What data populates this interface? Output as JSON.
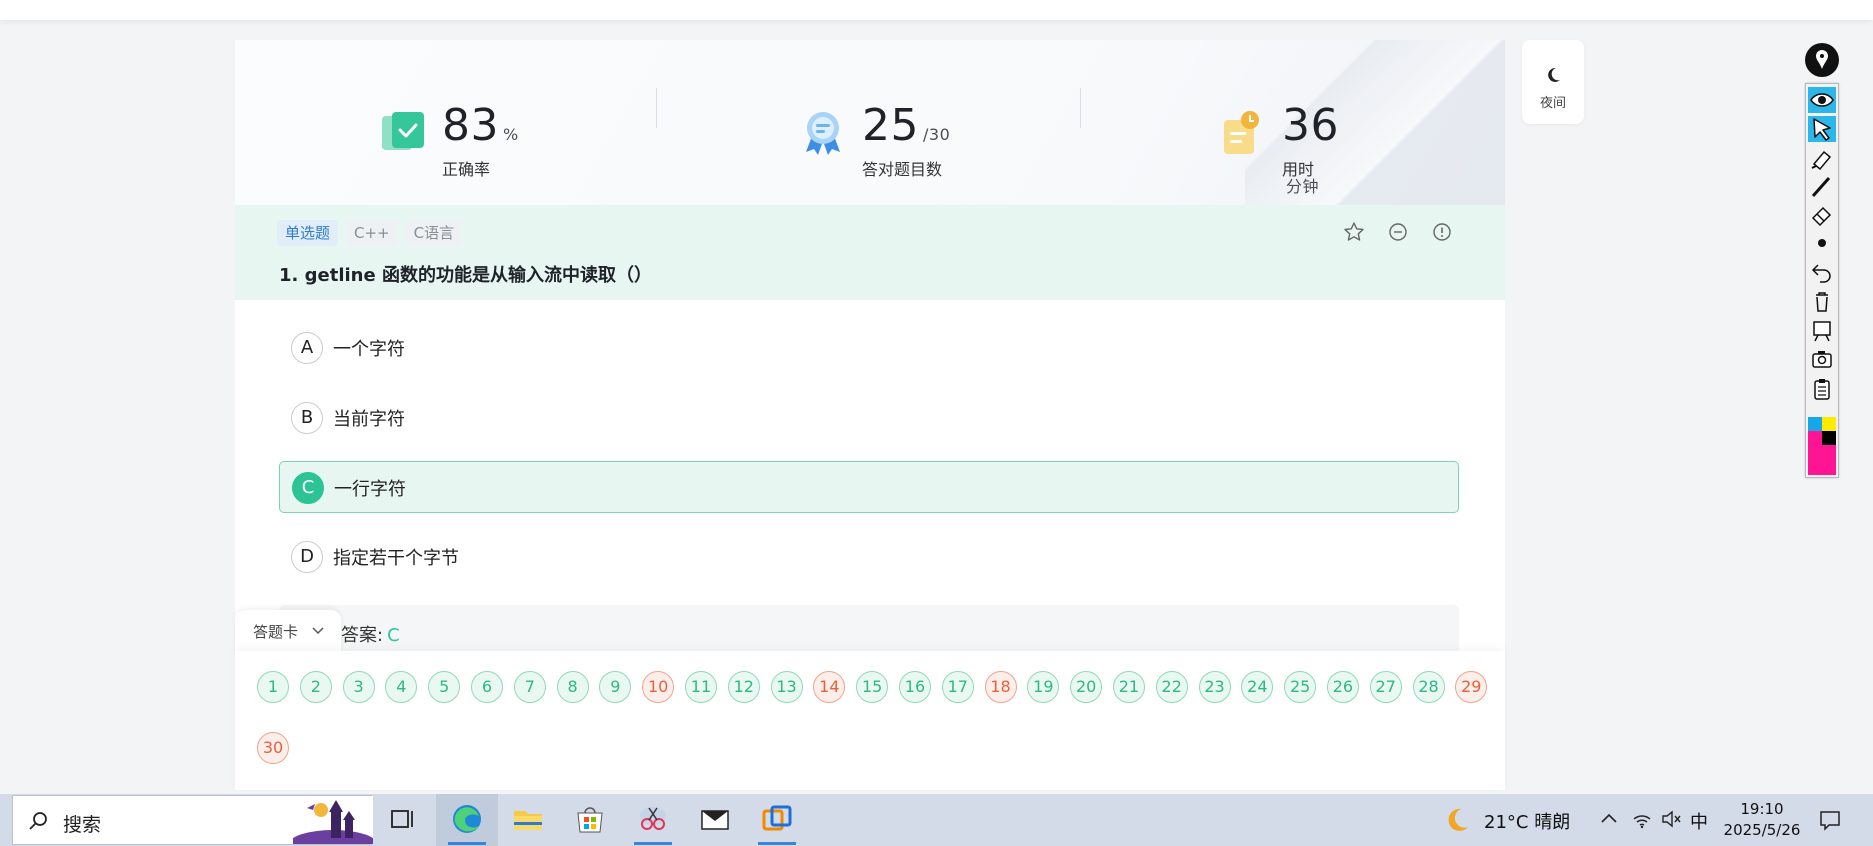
{
  "stats": [
    {
      "value": "83",
      "unit": "%",
      "label": "正确率"
    },
    {
      "value": "25",
      "unit": "/30",
      "label": "答对题目数"
    },
    {
      "value": "36",
      "unit": "分钟",
      "label": "用时"
    }
  ],
  "night_mode": {
    "label": "夜间"
  },
  "question": {
    "tags": [
      "单选题",
      "C++",
      "C语言"
    ],
    "title": "1. getline 函数的功能是从输入流中读取（）",
    "options": [
      {
        "letter": "A",
        "text": "一个字符",
        "selected": false
      },
      {
        "letter": "B",
        "text": "当前字符",
        "selected": false
      },
      {
        "letter": "C",
        "text": "一行字符",
        "selected": true
      },
      {
        "letter": "D",
        "text": "指定若干个字节",
        "selected": false
      }
    ],
    "answer_label": "答案:",
    "answer_value": "C"
  },
  "answer_sheet": {
    "label": "答题卡",
    "items": [
      {
        "n": "1",
        "status": "correct"
      },
      {
        "n": "2",
        "status": "correct"
      },
      {
        "n": "3",
        "status": "correct"
      },
      {
        "n": "4",
        "status": "correct"
      },
      {
        "n": "5",
        "status": "correct"
      },
      {
        "n": "6",
        "status": "correct"
      },
      {
        "n": "7",
        "status": "correct"
      },
      {
        "n": "8",
        "status": "correct"
      },
      {
        "n": "9",
        "status": "correct"
      },
      {
        "n": "10",
        "status": "wrong"
      },
      {
        "n": "11",
        "status": "correct"
      },
      {
        "n": "12",
        "status": "correct"
      },
      {
        "n": "13",
        "status": "correct"
      },
      {
        "n": "14",
        "status": "wrong"
      },
      {
        "n": "15",
        "status": "correct"
      },
      {
        "n": "16",
        "status": "correct"
      },
      {
        "n": "17",
        "status": "correct"
      },
      {
        "n": "18",
        "status": "wrong"
      },
      {
        "n": "19",
        "status": "correct"
      },
      {
        "n": "20",
        "status": "correct"
      },
      {
        "n": "21",
        "status": "correct"
      },
      {
        "n": "22",
        "status": "correct"
      },
      {
        "n": "23",
        "status": "correct"
      },
      {
        "n": "24",
        "status": "correct"
      },
      {
        "n": "25",
        "status": "correct"
      },
      {
        "n": "26",
        "status": "correct"
      },
      {
        "n": "27",
        "status": "correct"
      },
      {
        "n": "28",
        "status": "correct"
      },
      {
        "n": "29",
        "status": "wrong"
      },
      {
        "n": "30",
        "status": "wrong"
      }
    ]
  },
  "taskbar": {
    "search_placeholder": "搜索",
    "weather": "21°C  晴朗",
    "ime": "中",
    "time": "19:10",
    "date": "2025/5/26"
  },
  "colors": {
    "accent_green": "#2cc495",
    "wrong_red": "#e5613e",
    "tag_blue": "#2f7bd3",
    "toolbar_active": "#2bb7ea"
  }
}
